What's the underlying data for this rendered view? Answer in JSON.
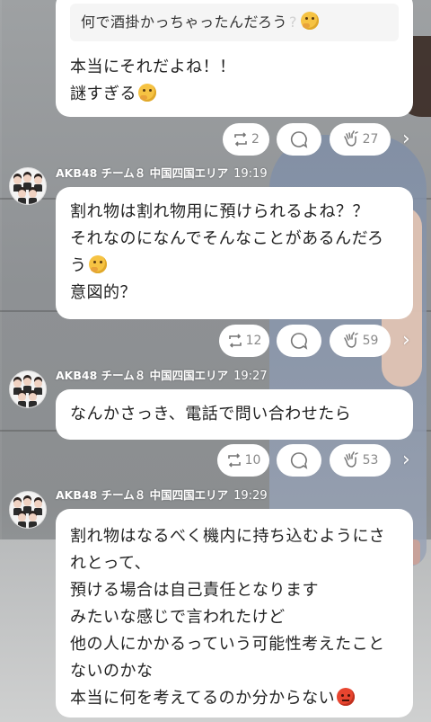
{
  "quote": {
    "text": "何で酒掛かっちゃったんだろう",
    "mark": "?"
  },
  "messages": [
    {
      "lines": [
        "本当にそれだよね！！",
        "謎すぎる"
      ]
    },
    {
      "sender": "AKB48 チーム８ 中国四国エリア",
      "time": "19:19",
      "lines": [
        "割れ物は割れ物用に預けられるよね？？",
        "それなのになんでそんなことがあるんだろ",
        "う",
        "意図的？"
      ]
    },
    {
      "sender": "AKB48 チーム８ 中国四国エリア",
      "time": "19:27",
      "lines": [
        "なんかさっき、電話で問い合わせたら"
      ]
    },
    {
      "sender": "AKB48 チーム８ 中国四国エリア",
      "time": "19:29",
      "lines": [
        "割れ物はなるべく機内に持ち込むようにさ",
        "れとって、",
        "預ける場合は自己責任となります",
        "みたいな感じで言われたけど",
        "他の人にかかるっていう可能性考えたこと",
        "ないのかな",
        "本当に何を考えてるのか分からない"
      ]
    }
  ],
  "reactions": [
    {
      "repost": "2",
      "clap": "27"
    },
    {
      "repost": "12",
      "clap": "59"
    },
    {
      "repost": "10",
      "clap": "53"
    }
  ],
  "icons": {
    "repost": "repost-icon",
    "comment": "comment-icon",
    "clap": "clap-icon",
    "chevron": "chevron-right-icon",
    "think": "thinking-face-emoji",
    "angry": "angry-face-emoji"
  },
  "colors": {
    "bubble": "#ffffff",
    "icon": "#777777",
    "count": "#8a8a8a"
  }
}
